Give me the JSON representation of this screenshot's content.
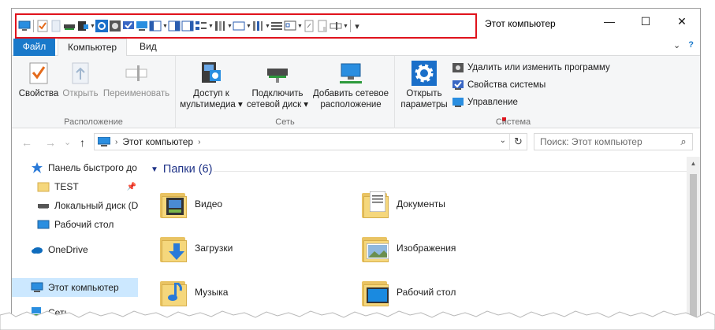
{
  "window": {
    "title": "Этот компьютер",
    "controls": {
      "minimize": "—",
      "maximize": "☐",
      "close": "✕"
    }
  },
  "quick_access_toolbar": {
    "icons": [
      "computer-icon",
      "properties-icon",
      "blank-page-icon",
      "drive-icon",
      "media-icon",
      "settings-icon",
      "disk-icon",
      "system-icon",
      "network-icon",
      "pane-icon",
      "preview-icon",
      "details-icon",
      "layout-icon",
      "columns-icon",
      "view-icon",
      "group-icon",
      "size-icon",
      "checkbox-icon",
      "page-icon",
      "page2-icon",
      "options-icon"
    ],
    "more": "▾"
  },
  "tabs": {
    "file": "Файл",
    "computer": "Компьютер",
    "view": "Вид",
    "collapse": "⌄",
    "help": "?"
  },
  "ribbon": {
    "location": {
      "label": "Расположение",
      "properties": "Свойства",
      "open": "Открыть",
      "rename": "Переименовать"
    },
    "network": {
      "label": "Сеть",
      "media_line1": "Доступ к",
      "media_line2": "мультимедиа ▾",
      "map_line1": "Подключить",
      "map_line2": "сетевой диск ▾",
      "add_line1": "Добавить сетевое",
      "add_line2": "расположение"
    },
    "system": {
      "label": "Система",
      "settings_line1": "Открыть",
      "settings_line2": "параметры",
      "uninstall": "Удалить или изменить программу",
      "sysprops": "Свойства системы",
      "manage": "Управление"
    }
  },
  "navigation": {
    "back": "←",
    "forward": "→",
    "recent": "⌄",
    "up": "↑",
    "address_chevron": "›",
    "address_crumb": "Этот компьютер",
    "address_chevron2": "›",
    "dropdown": "⌄",
    "refresh": "↻",
    "search_placeholder": "Поиск: Этот компьютер",
    "search_icon": "⌕"
  },
  "nav_pane": {
    "items": [
      {
        "label": "Панель быстрого до",
        "icon": "star-icon"
      },
      {
        "label": "TEST",
        "icon": "folder-icon",
        "pin": "📌"
      },
      {
        "label": "Локальный диск (D",
        "icon": "drive-icon"
      },
      {
        "label": "Рабочий стол",
        "icon": "desktop-icon"
      },
      {
        "label": "OneDrive",
        "icon": "onedrive-icon"
      },
      {
        "label": "Этот компьютер",
        "icon": "computer-icon"
      },
      {
        "label": "Сеть",
        "icon": "network-icon"
      }
    ]
  },
  "content": {
    "section_title": "Папки (6)",
    "folders": [
      {
        "name": "Видео",
        "icon": "video-folder-icon"
      },
      {
        "name": "Документы",
        "icon": "documents-folder-icon"
      },
      {
        "name": "Загрузки",
        "icon": "downloads-folder-icon"
      },
      {
        "name": "Изображения",
        "icon": "pictures-folder-icon"
      },
      {
        "name": "Музыка",
        "icon": "music-folder-icon"
      },
      {
        "name": "Рабочий стол",
        "icon": "desktop-folder-icon"
      }
    ]
  },
  "colors": {
    "accent": "#1979ca",
    "highlight": "#e0131c",
    "selected": "#cce8ff",
    "folder": "#f5d77c",
    "section_title": "#1e3287"
  }
}
